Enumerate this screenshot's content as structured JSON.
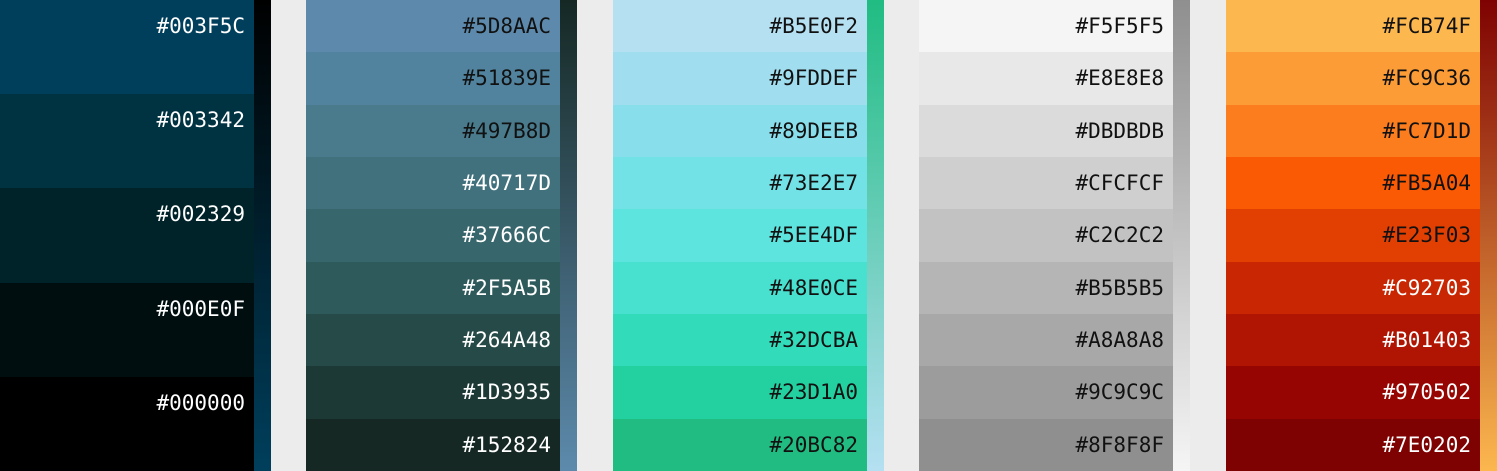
{
  "palettes": [
    {
      "swatches": [
        {
          "hex": "#003F5C",
          "text_color": "#ffffff"
        },
        {
          "hex": "#003342",
          "text_color": "#ffffff"
        },
        {
          "hex": "#002329",
          "text_color": "#ffffff"
        },
        {
          "hex": "#000E0F",
          "text_color": "#ffffff"
        },
        {
          "hex": "#000000",
          "text_color": "#ffffff"
        }
      ],
      "gradient": [
        "#000000",
        "#003F5C"
      ]
    },
    {
      "swatches": [
        {
          "hex": "#5D8AAC",
          "text_color": "#111111"
        },
        {
          "hex": "#51839E",
          "text_color": "#111111"
        },
        {
          "hex": "#497B8D",
          "text_color": "#111111"
        },
        {
          "hex": "#40717D",
          "text_color": "#ffffff"
        },
        {
          "hex": "#37666C",
          "text_color": "#ffffff"
        },
        {
          "hex": "#2F5A5B",
          "text_color": "#ffffff"
        },
        {
          "hex": "#264A48",
          "text_color": "#ffffff"
        },
        {
          "hex": "#1D3935",
          "text_color": "#ffffff"
        },
        {
          "hex": "#152824",
          "text_color": "#ffffff"
        }
      ],
      "gradient": [
        "#152824",
        "#5D8AAC"
      ]
    },
    {
      "swatches": [
        {
          "hex": "#B5E0F2",
          "text_color": "#111111"
        },
        {
          "hex": "#9FDDEF",
          "text_color": "#111111"
        },
        {
          "hex": "#89DEEB",
          "text_color": "#111111"
        },
        {
          "hex": "#73E2E7",
          "text_color": "#111111"
        },
        {
          "hex": "#5EE4DF",
          "text_color": "#111111"
        },
        {
          "hex": "#48E0CE",
          "text_color": "#111111"
        },
        {
          "hex": "#32DCBA",
          "text_color": "#111111"
        },
        {
          "hex": "#23D1A0",
          "text_color": "#111111"
        },
        {
          "hex": "#20BC82",
          "text_color": "#111111"
        }
      ],
      "gradient": [
        "#20BC82",
        "#B5E0F2"
      ]
    },
    {
      "swatches": [
        {
          "hex": "#F5F5F5",
          "text_color": "#111111"
        },
        {
          "hex": "#E8E8E8",
          "text_color": "#111111"
        },
        {
          "hex": "#DBDBDB",
          "text_color": "#111111"
        },
        {
          "hex": "#CFCFCF",
          "text_color": "#111111"
        },
        {
          "hex": "#C2C2C2",
          "text_color": "#111111"
        },
        {
          "hex": "#B5B5B5",
          "text_color": "#111111"
        },
        {
          "hex": "#A8A8A8",
          "text_color": "#111111"
        },
        {
          "hex": "#9C9C9C",
          "text_color": "#111111"
        },
        {
          "hex": "#8F8F8F",
          "text_color": "#111111"
        }
      ],
      "gradient": [
        "#8F8F8F",
        "#F5F5F5"
      ]
    },
    {
      "swatches": [
        {
          "hex": "#FCB74F",
          "text_color": "#111111"
        },
        {
          "hex": "#FC9C36",
          "text_color": "#111111"
        },
        {
          "hex": "#FC7D1D",
          "text_color": "#111111"
        },
        {
          "hex": "#FB5A04",
          "text_color": "#111111"
        },
        {
          "hex": "#E23F03",
          "text_color": "#111111"
        },
        {
          "hex": "#C92703",
          "text_color": "#ffffff"
        },
        {
          "hex": "#B01403",
          "text_color": "#ffffff"
        },
        {
          "hex": "#970502",
          "text_color": "#ffffff"
        },
        {
          "hex": "#7E0202",
          "text_color": "#ffffff"
        }
      ],
      "gradient": [
        "#7E0202",
        "#FCB74F"
      ]
    }
  ]
}
